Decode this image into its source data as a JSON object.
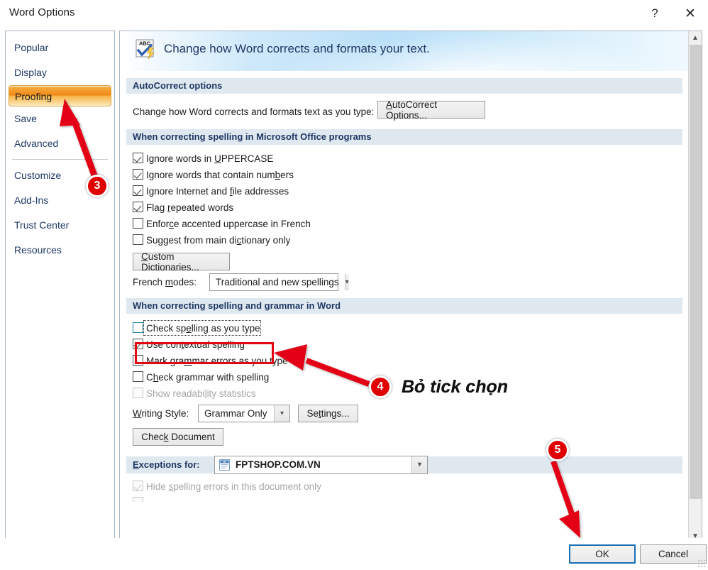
{
  "window": {
    "title": "Word Options",
    "help_icon": "question-mark-icon",
    "close_icon": "close-icon"
  },
  "sidebar": {
    "items": [
      {
        "label": "Popular",
        "selected": false
      },
      {
        "label": "Display",
        "selected": false
      },
      {
        "label": "Proofing",
        "selected": true
      },
      {
        "label": "Save",
        "selected": false
      },
      {
        "label": "Advanced",
        "selected": false
      },
      {
        "label": "Customize",
        "selected": false
      },
      {
        "label": "Add-Ins",
        "selected": false
      },
      {
        "label": "Trust Center",
        "selected": false
      },
      {
        "label": "Resources",
        "selected": false
      }
    ]
  },
  "banner": {
    "icon": "spelling-abc-check-icon",
    "title": "Change how Word corrects and formats your text."
  },
  "sections": {
    "autocorrect": {
      "heading": "AutoCorrect options",
      "description": "Change how Word corrects and formats text as you type:",
      "button_label": "AutoCorrect Options..."
    },
    "office_spelling": {
      "heading": "When correcting spelling in Microsoft Office programs",
      "checkboxes": [
        {
          "label": "Ignore words in UPPERCASE",
          "checked": true,
          "disabled": false
        },
        {
          "label": "Ignore words that contain numbers",
          "checked": true,
          "disabled": false
        },
        {
          "label": "Ignore Internet and file addresses",
          "checked": true,
          "disabled": false
        },
        {
          "label": "Flag repeated words",
          "checked": true,
          "disabled": false
        },
        {
          "label": "Enforce accented uppercase in French",
          "checked": false,
          "disabled": false
        },
        {
          "label": "Suggest from main dictionary only",
          "checked": false,
          "disabled": false
        }
      ],
      "custom_dictionaries_label": "Custom Dictionaries...",
      "french_modes_label": "French modes:",
      "french_modes_value": "Traditional and new spellings"
    },
    "word_spelling": {
      "heading": "When correcting spelling and grammar in Word",
      "checkboxes": [
        {
          "label": "Check spelling as you type",
          "checked": false,
          "disabled": false
        },
        {
          "label": "Use contextual spelling",
          "checked": true,
          "disabled": false
        },
        {
          "label": "Mark grammar errors as you type",
          "checked": false,
          "disabled": false
        },
        {
          "label": "Check grammar with spelling",
          "checked": false,
          "disabled": false
        },
        {
          "label": "Show readability statistics",
          "checked": false,
          "disabled": true
        }
      ],
      "writing_style_label": "Writing Style:",
      "writing_style_value": "Grammar Only",
      "settings_label": "Settings...",
      "check_document_label": "Check Document"
    },
    "exceptions": {
      "heading": "Exceptions for:",
      "document_icon": "word-document-icon",
      "document_value": "FPTSHOP.COM.VN",
      "checkboxes": [
        {
          "label": "Hide spelling errors in this document only",
          "checked": true,
          "disabled": true
        }
      ]
    }
  },
  "footer": {
    "ok_label": "OK",
    "cancel_label": "Cancel"
  },
  "scrollbar": {
    "up_icon": "chevron-up-icon",
    "down_icon": "chevron-down-icon"
  },
  "annotations": {
    "step3": "3",
    "step4": "4",
    "step5": "5",
    "caption4": "Bỏ tick chọn",
    "accent_color": "#e30613",
    "badge_color": "#e00000"
  }
}
